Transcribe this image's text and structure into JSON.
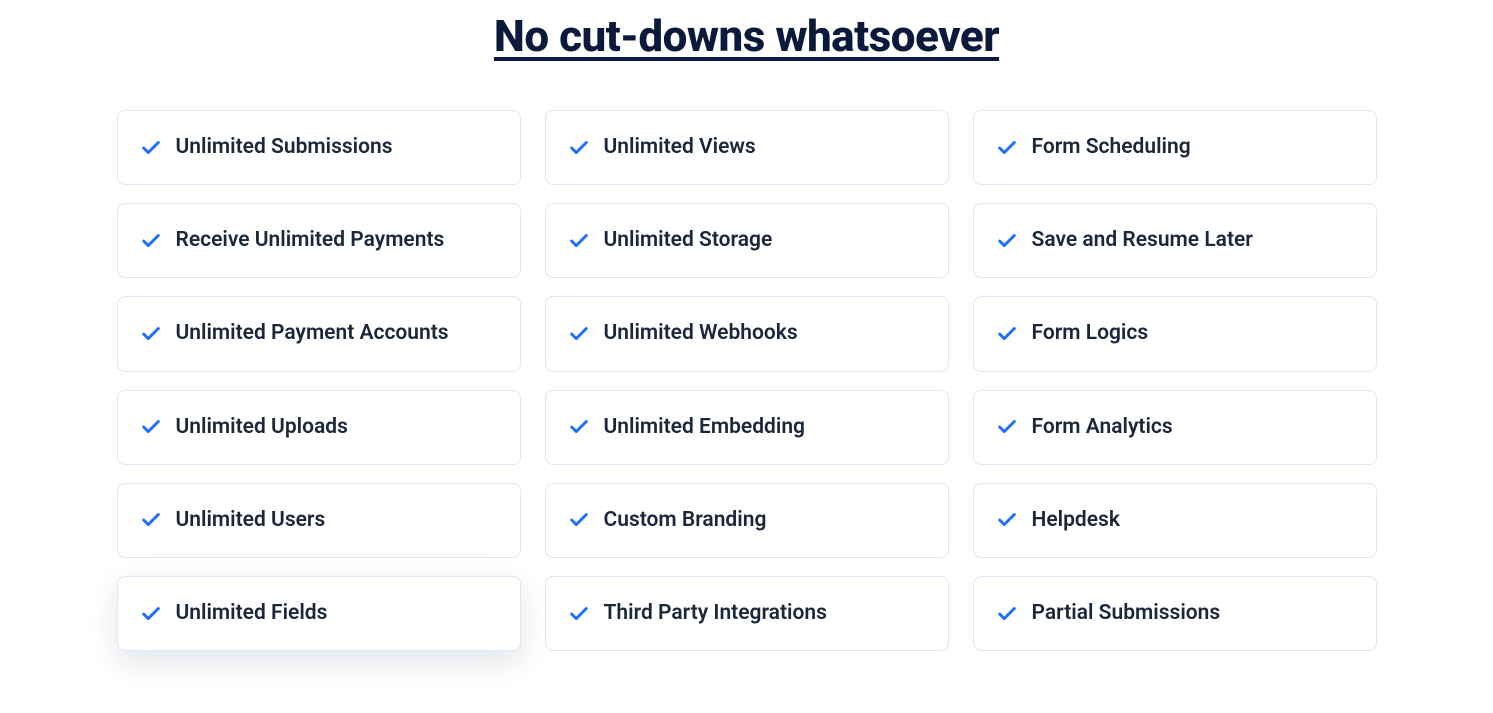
{
  "heading": "No cut-downs whatsoever",
  "colors": {
    "accent": "#1f6fff",
    "text": "#1c273c",
    "heading": "#0b1a3a",
    "border": "#dbe7f5"
  },
  "features": [
    {
      "label": "Unlimited Submissions",
      "highlighted": false
    },
    {
      "label": "Unlimited Views",
      "highlighted": false
    },
    {
      "label": "Form Scheduling",
      "highlighted": false
    },
    {
      "label": "Receive Unlimited Payments",
      "highlighted": false
    },
    {
      "label": "Unlimited Storage",
      "highlighted": false
    },
    {
      "label": "Save and Resume Later",
      "highlighted": false
    },
    {
      "label": "Unlimited Payment Accounts",
      "highlighted": false
    },
    {
      "label": "Unlimited Webhooks",
      "highlighted": false
    },
    {
      "label": "Form Logics",
      "highlighted": false
    },
    {
      "label": "Unlimited Uploads",
      "highlighted": false
    },
    {
      "label": "Unlimited Embedding",
      "highlighted": false
    },
    {
      "label": "Form Analytics",
      "highlighted": false
    },
    {
      "label": "Unlimited Users",
      "highlighted": false
    },
    {
      "label": "Custom Branding",
      "highlighted": false
    },
    {
      "label": "Helpdesk",
      "highlighted": false
    },
    {
      "label": "Unlimited Fields",
      "highlighted": true
    },
    {
      "label": "Third Party Integrations",
      "highlighted": false
    },
    {
      "label": "Partial Submissions",
      "highlighted": false
    }
  ]
}
